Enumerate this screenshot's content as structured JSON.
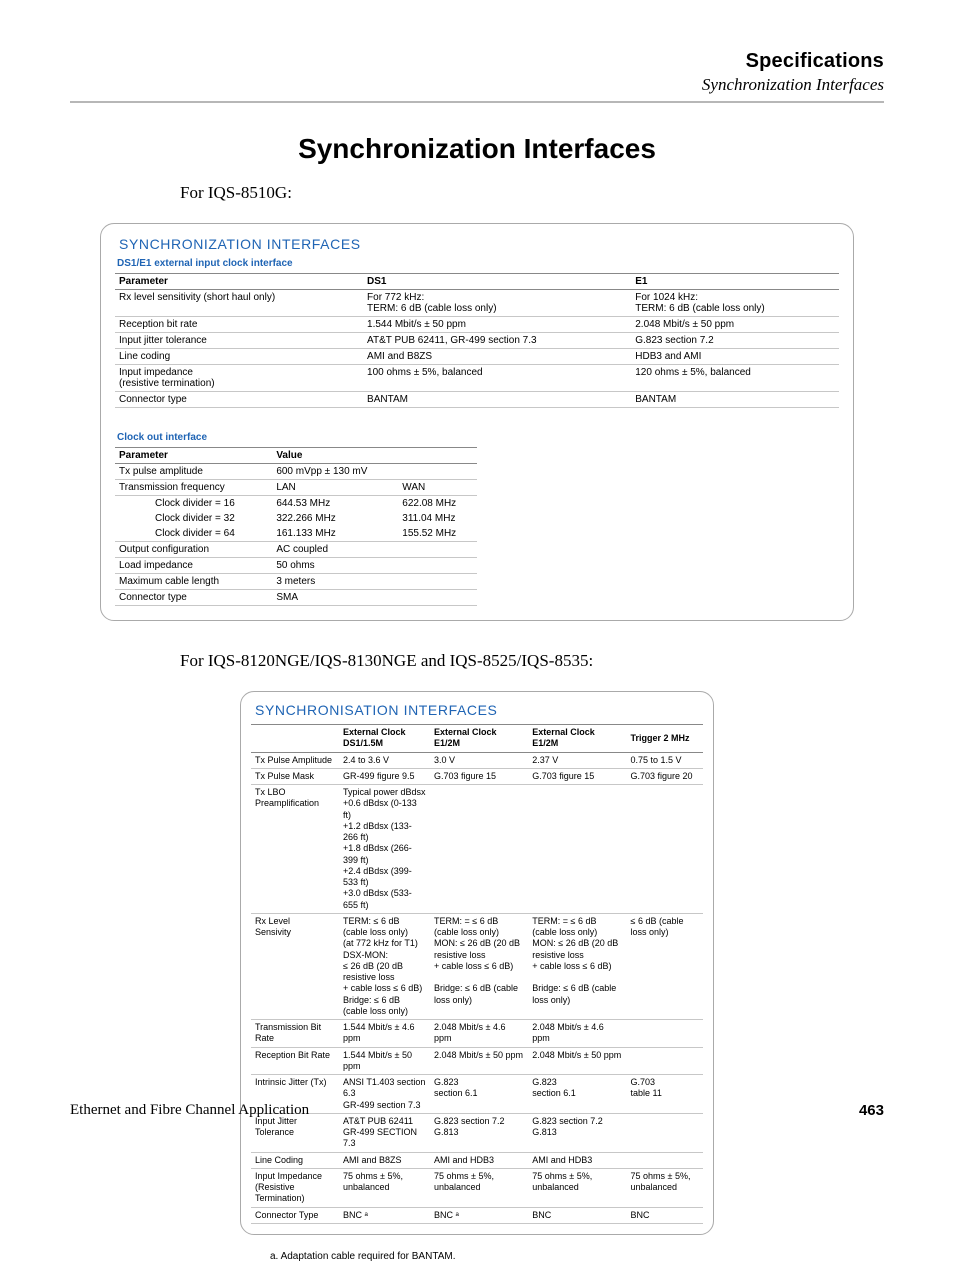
{
  "header": {
    "title": "Specifications",
    "subtitle": "Synchronization Interfaces"
  },
  "main_title": "Synchronization Interfaces",
  "sub1": "For IQS-8510G:",
  "box1": {
    "title": "SYNCHRONIZATION INTERFACES",
    "section1_label": "DS1/E1 external input clock interface",
    "section2_label": "Clock out interface",
    "t1_head": [
      "Parameter",
      "DS1",
      "E1"
    ],
    "t1_rows": [
      [
        "Rx level sensitivity (short haul only)",
        "For 772 kHz:\nTERM: 6 dB (cable loss only)",
        "For 1024 kHz:\nTERM: 6 dB (cable loss only)"
      ],
      [
        "Reception bit rate",
        "1.544 Mbit/s ± 50 ppm",
        "2.048 Mbit/s ± 50 ppm"
      ],
      [
        "Input jitter tolerance",
        "AT&T PUB 62411, GR-499 section 7.3",
        "G.823 section 7.2"
      ],
      [
        "Line coding",
        "AMI and B8ZS",
        "HDB3 and AMI"
      ],
      [
        "Input impedance\n(resistive termination)",
        "100 ohms ± 5%, balanced",
        "120 ohms ± 5%, balanced"
      ],
      [
        "Connector type",
        "BANTAM",
        "BANTAM"
      ]
    ],
    "t2_head": [
      "Parameter",
      "Value",
      ""
    ],
    "t2_rows": [
      {
        "cells": [
          "Tx pulse amplitude",
          "600 mVpp ± 130 mV",
          ""
        ],
        "indent": false
      },
      {
        "cells": [
          "Transmission frequency",
          "LAN",
          "WAN"
        ],
        "indent": false
      },
      {
        "cells": [
          "Clock divider = 16",
          "644.53 MHz",
          "622.08 MHz"
        ],
        "indent": true,
        "nb": true
      },
      {
        "cells": [
          "Clock divider = 32",
          "322.266 MHz",
          "311.04 MHz"
        ],
        "indent": true,
        "nb": true
      },
      {
        "cells": [
          "Clock divider = 64",
          "161.133 MHz",
          "155.52 MHz"
        ],
        "indent": true
      },
      {
        "cells": [
          "Output configuration",
          "AC coupled",
          ""
        ],
        "indent": false
      },
      {
        "cells": [
          "Load impedance",
          "50 ohms",
          ""
        ],
        "indent": false
      },
      {
        "cells": [
          "Maximum cable length",
          "3 meters",
          ""
        ],
        "indent": false
      },
      {
        "cells": [
          "Connector type",
          "SMA",
          ""
        ],
        "indent": false
      }
    ]
  },
  "sub2": "For IQS-8120NGE/IQS-8130NGE and IQS-8525/IQS-8535:",
  "box2": {
    "title": "SYNCHRONISATION INTERFACES",
    "head": [
      "",
      "External Clock DS1/1.5M",
      "External Clock E1/2M",
      "External Clock E1/2M",
      "Trigger 2 MHz"
    ],
    "rows": [
      [
        "Tx Pulse Amplitude",
        "2.4 to 3.6 V",
        "3.0 V",
        "2.37 V",
        "0.75 to 1.5 V"
      ],
      [
        "Tx Pulse Mask",
        "GR-499 figure 9.5",
        "G.703 figure 15",
        "G.703 figure 15",
        "G.703 figure 20"
      ],
      [
        "Tx LBO\nPreamplification",
        "Typical power dBdsx\n+0.6 dBdsx (0-133 ft)\n+1.2 dBdsx (133-266 ft)\n+1.8 dBdsx (266-399 ft)\n+2.4 dBdsx (399-533 ft)\n+3.0 dBdsx (533-655 ft)",
        "",
        "",
        ""
      ],
      [
        "Rx Level\nSensivity",
        "TERM: ≤ 6 dB (cable loss only)\n(at 772 kHz for T1) DSX-MON:\n≤ 26 dB (20 dB resistive loss\n+ cable loss ≤ 6 dB)\nBridge: ≤ 6 dB (cable loss only)",
        "TERM: = ≤ 6 dB (cable loss only)\nMON: ≤ 26 dB (20 dB resistive loss\n+ cable loss ≤ 6 dB)\n\nBridge: ≤ 6 dB (cable loss only)",
        "TERM: = ≤ 6 dB (cable loss only)\nMON: ≤ 26 dB (20 dB resistive loss\n+ cable loss ≤ 6 dB)\n\nBridge: ≤ 6 dB (cable loss only)",
        "≤ 6 dB (cable loss only)"
      ],
      [
        "Transmission Bit Rate",
        "1.544 Mbit/s ± 4.6 ppm",
        "2.048 Mbit/s ± 4.6 ppm",
        "2.048 Mbit/s ± 4.6 ppm",
        ""
      ],
      [
        "Reception Bit Rate",
        "1.544 Mbit/s ± 50 ppm",
        "2.048 Mbit/s ± 50 ppm",
        "2.048 Mbit/s ± 50 ppm",
        ""
      ],
      [
        "Intrinsic Jitter (Tx)",
        "ANSI T1.403 section 6.3\nGR-499 section 7.3",
        "G.823\nsection 6.1",
        "G.823\nsection 6.1",
        "G.703\ntable 11"
      ],
      [
        "Input Jitter\nTolerance",
        "AT&T PUB 62411\nGR-499 SECTION 7.3",
        "G.823 section 7.2\nG.813",
        "G.823 section 7.2\nG.813",
        ""
      ],
      [
        "Line Coding",
        "AMI and B8ZS",
        "AMI and HDB3",
        "AMI and HDB3",
        ""
      ],
      [
        "Input Impedance\n(Resistive Termination)",
        "75 ohms ± 5%,\nunbalanced",
        "75 ohms ± 5%,\nunbalanced",
        "75 ohms ± 5%,\nunbalanced",
        "75 ohms ± 5%,\nunbalanced"
      ],
      [
        "Connector Type",
        "BNC ᵃ",
        "BNC ᵃ",
        "BNC",
        "BNC"
      ]
    ]
  },
  "footnote": "a.  Adaptation cable required for BANTAM.",
  "footer": {
    "left": "Ethernet and Fibre Channel Application",
    "page": "463"
  }
}
